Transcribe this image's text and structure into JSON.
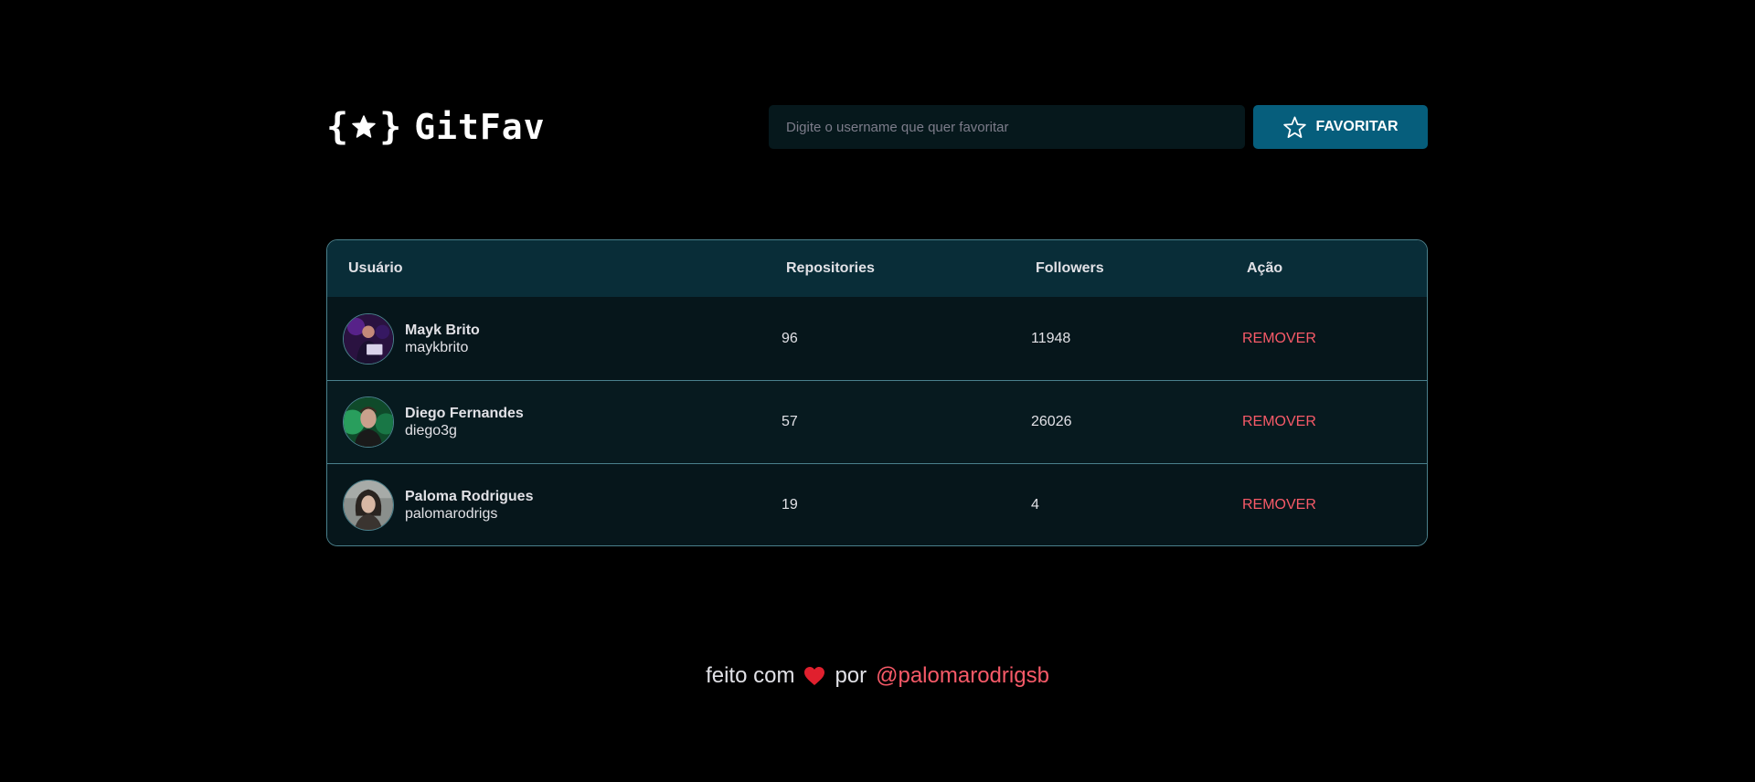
{
  "app": {
    "logo_text": "GitFav"
  },
  "search": {
    "placeholder": "Digite o username que quer favoritar",
    "value": "",
    "button_label": "FAVORITAR"
  },
  "table": {
    "headers": {
      "user": "Usuário",
      "repositories": "Repositories",
      "followers": "Followers",
      "action": "Ação"
    },
    "rows": [
      {
        "name": "Mayk Brito",
        "login": "maykbrito",
        "repositories": "96",
        "followers": "11948",
        "action": "REMOVER"
      },
      {
        "name": "Diego Fernandes",
        "login": "diego3g",
        "repositories": "57",
        "followers": "26026",
        "action": "REMOVER"
      },
      {
        "name": "Paloma Rodrigues",
        "login": "palomarodrigs",
        "repositories": "19",
        "followers": "4",
        "action": "REMOVER"
      }
    ]
  },
  "footer": {
    "prefix": "feito com",
    "middle": "por",
    "author_link": "@palomarodrigsb"
  },
  "colors": {
    "background": "#000000",
    "accent": "#065e7c",
    "header_row": "#092d38",
    "danger": "#f75a68",
    "border": "#4a808c"
  },
  "icons": {
    "logo": "star-braces-icon",
    "favorite_button": "star-outline-icon",
    "footer": "heart-icon"
  }
}
